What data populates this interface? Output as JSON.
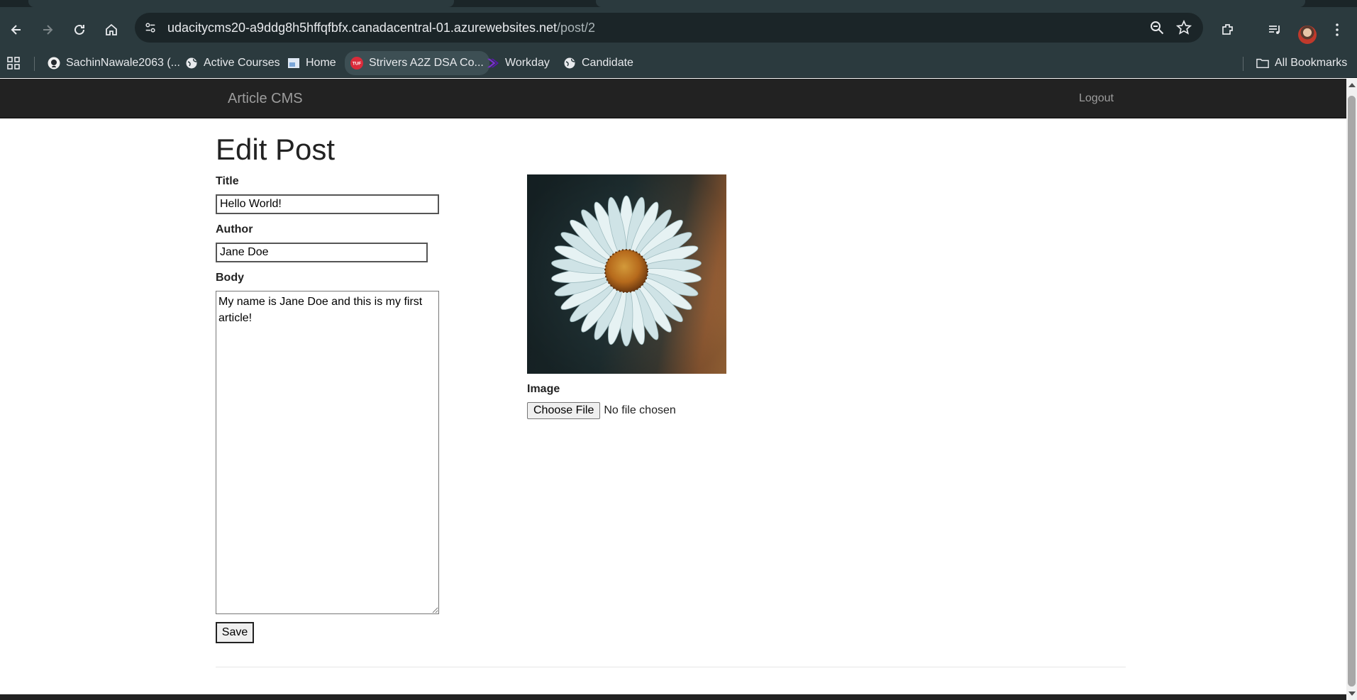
{
  "browser": {
    "url_host": "udacitycms20-a9ddg8h5hffqfbfx.canadacentral-01.azurewebsites.net",
    "url_path": "/post/2",
    "bookmarks": [
      {
        "label": "SachinNawale2063 (...",
        "icon": "github-icon"
      },
      {
        "label": "Active Courses",
        "icon": "globe-icon"
      },
      {
        "label": "Home",
        "icon": "page-icon"
      },
      {
        "label": "Strivers A2Z DSA Co...",
        "icon": "tuf-icon"
      },
      {
        "label": "Workday",
        "icon": "workday-icon"
      },
      {
        "label": "Candidate",
        "icon": "globe-icon"
      }
    ],
    "all_bookmarks_label": "All Bookmarks"
  },
  "nav": {
    "brand": "Article CMS",
    "logout": "Logout"
  },
  "page": {
    "title": "Edit Post"
  },
  "form": {
    "title_label": "Title",
    "title_value": "Hello World!",
    "author_label": "Author",
    "author_value": "Jane Doe",
    "body_label": "Body",
    "body_value": "My name is Jane Doe and this is my first article!",
    "image_label": "Image",
    "choose_file_label": "Choose File",
    "no_file_text": "No file chosen",
    "save_label": "Save"
  },
  "colors": {
    "navbar": "#222222",
    "nav_link": "#9d9d9d",
    "browser_chrome": "#2b3a3e"
  }
}
